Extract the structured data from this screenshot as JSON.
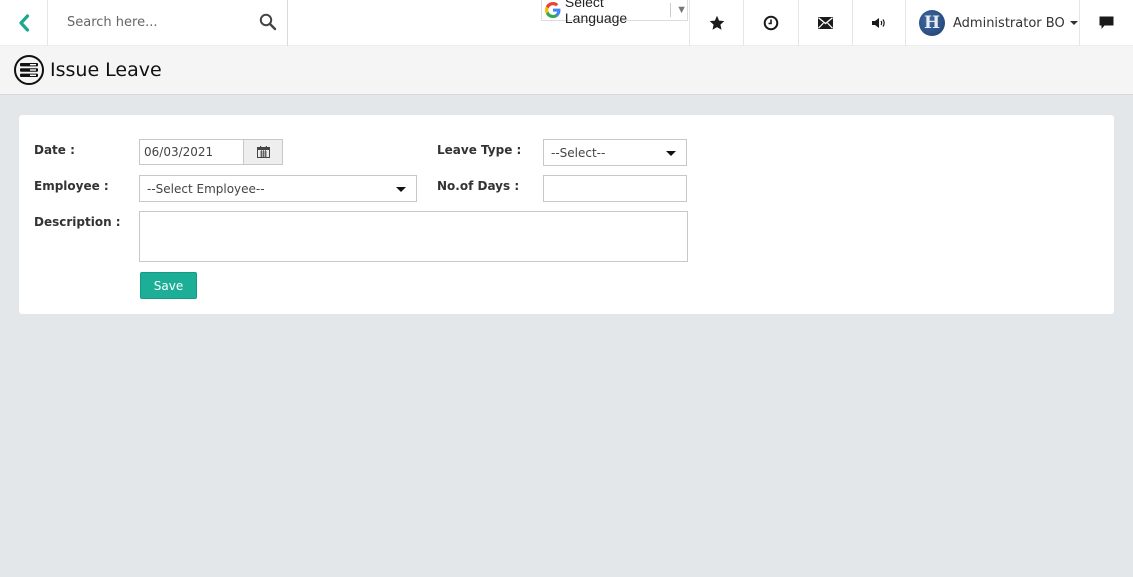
{
  "topbar": {
    "search_placeholder": "Search here...",
    "language_label": "Select Language",
    "user_name": "Administrator BO",
    "avatar_letter": "H",
    "icons": [
      "back-chevron-icon",
      "search-icon",
      "google-icon",
      "star-icon",
      "clock-icon",
      "envelope-icon",
      "volume-icon",
      "chat-icon"
    ]
  },
  "page": {
    "title": "Issue Leave"
  },
  "form": {
    "date_label": "Date :",
    "date_value": "06/03/2021",
    "employee_label": "Employee :",
    "employee_selected": "--Select Employee--",
    "description_label": "Description :",
    "description_value": "",
    "leave_type_label": "Leave Type :",
    "leave_type_selected": "--Select--",
    "days_label": "No.of Days :",
    "days_value": "",
    "save_label": "Save"
  },
  "colors": {
    "accent": "#1cae96",
    "background": "#e4e7ea"
  }
}
